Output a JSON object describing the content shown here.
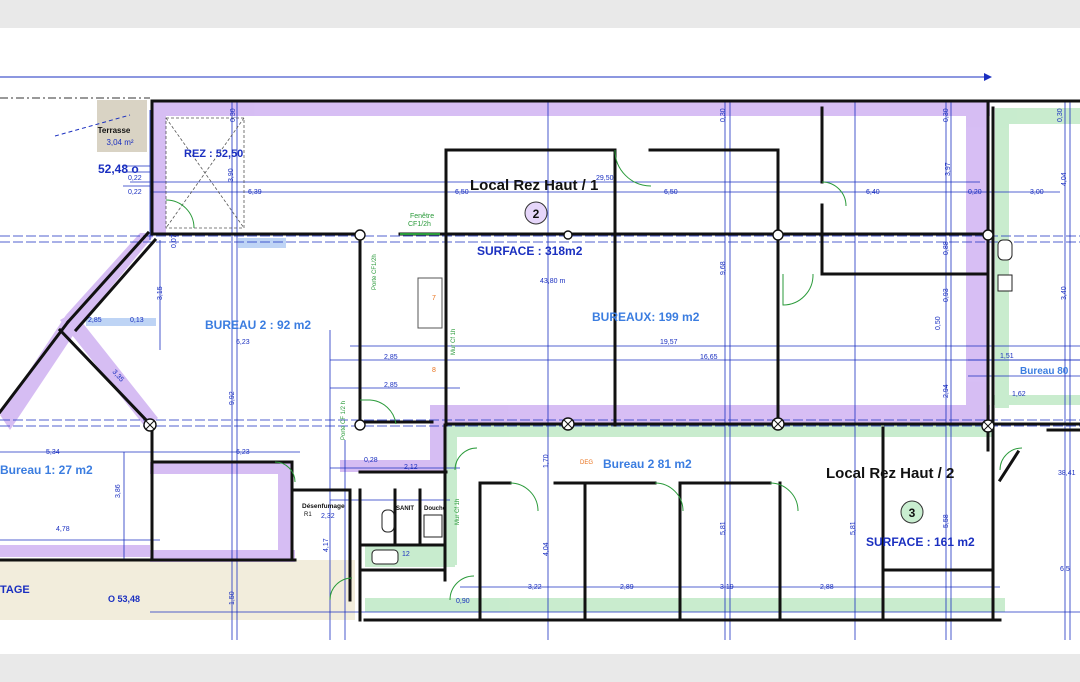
{
  "colors": {
    "outer_bg": "#e9e9e9",
    "paper": "#ffffff",
    "purple_zone": "#c9a8f0",
    "green_zone": "#bfe9c6",
    "wall": "#111111",
    "dim_blue": "#1a2fc0",
    "room_blue": "#3b7de0",
    "terrace_fill": "#d9d3c4",
    "door_green": "#2a9a3a",
    "orange": "#e8701a"
  },
  "labels": {
    "terrasse_title": "Terrasse",
    "terrasse_area": "3,04 m²",
    "area_52_48": "52,48 o",
    "rez_area": "REZ : 52,50",
    "local1_title": "Local Rez Haut / 1",
    "local1_number": "2",
    "local1_surface": "SURFACE : 318m2",
    "bureaux_area": "BUREAUX: 199 m2",
    "bureau2_top": "BUREAU 2  : 92 m2",
    "bureau1": "Bureau 1: 27 m2",
    "bureau2_bottom": "Bureau 2 81 m2",
    "bureau_right": "Bureau 80",
    "local2_title": "Local Rez Haut / 2",
    "local2_number": "3",
    "local2_surface": "SURFACE : 161 m2",
    "stage_text": "TAGE",
    "o_area": "O 53,48",
    "fenetre": "Fenêtre",
    "fenetre_rating": "CF1/2h",
    "porte_cf": "Porte CF1/2h",
    "porte_cf2": "Porte CF 1/2 h",
    "mur_cf": "Mur Cf 1h",
    "mur_cf2": "Mur Cf 1h",
    "desenfumage": "Désenfumage",
    "desenfumage_sub": "R1",
    "sanit": "SANIT",
    "douche": "Douche",
    "deg": "DEG",
    "len_43_80": "43,80 m"
  },
  "dimensions": {
    "d_030_a": "0,30",
    "d_030_b": "0,30",
    "d_030_c": "0,30",
    "d_030_d": "0,30",
    "d_022_a": "0,22",
    "d_022_b": "0,22",
    "d_390": "3,90",
    "d_639": "6,39",
    "d_650_a": "6,50",
    "d_650_b": "6,50",
    "d_2950": "29,50",
    "d_640": "6,40",
    "d_397": "3,97",
    "d_020_a": "0,20",
    "d_300": "3,00",
    "d_404": "4,04",
    "d_007_a": "0,07",
    "d_315": "3,15",
    "d_285_a": "2,85",
    "d_013": "0,13",
    "d_623_a": "6,23",
    "d_968": "9,68",
    "d_1957": "19,57",
    "d_1665": "16,65",
    "d_285_b": "2,85",
    "d_285_c": "2,85",
    "d_088": "0,88",
    "d_093": "0,93",
    "d_050": "0,50",
    "d_340": "3,40",
    "d_151": "1,51",
    "d_162": "1,62",
    "d_294": "2,94",
    "d_534": "5,34",
    "d_992": "9,92",
    "d_623_b": "6,23",
    "d_386": "3,86",
    "d_478": "4,78",
    "d_028": "0,28",
    "d_212": "2,12",
    "d_232": "2,32",
    "d_417": "4,17",
    "d_170": "1,70",
    "d_404_b": "4,04",
    "d_581_a": "5,81",
    "d_581_b": "5,81",
    "d_558": "5,58",
    "d_3841": "38,41",
    "d_322": "3,22",
    "d_289": "2,89",
    "d_319": "3,19",
    "d_288": "2,88",
    "d_150": "1,50",
    "d_090": "0,90",
    "d_335": "3,35",
    "d_065": "6,5",
    "d_012": "12",
    "d_008": "8",
    "d_007_7": "7"
  }
}
